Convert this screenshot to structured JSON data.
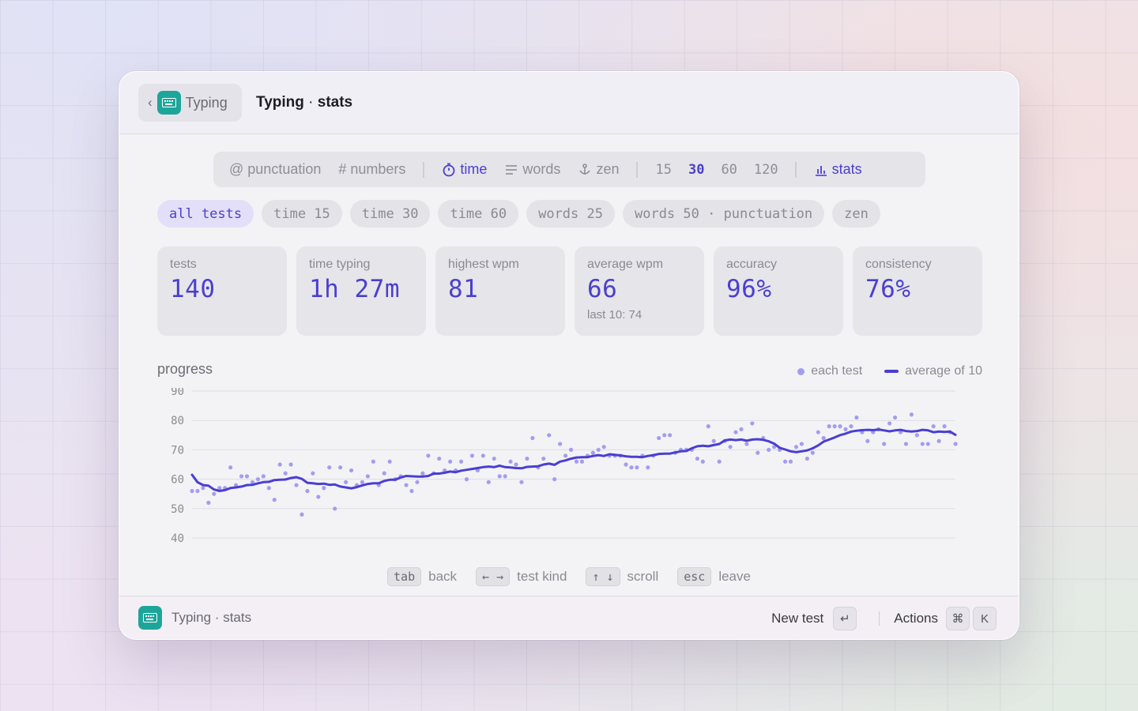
{
  "window": {
    "back_label": "Typing",
    "title_main": "Typing",
    "title_sep": " · ",
    "title_sub": "stats"
  },
  "modebar": {
    "items": [
      {
        "prefix": "@",
        "label": "punctuation"
      },
      {
        "prefix": "#",
        "label": "numbers"
      },
      {
        "label": "time",
        "icon": "stopwatch-icon",
        "active": true
      },
      {
        "label": "words",
        "icon": "lines-icon"
      },
      {
        "label": "zen",
        "icon": "anchor-icon"
      }
    ],
    "durations": [
      "15",
      "30",
      "60",
      "120"
    ],
    "active_duration": "30",
    "stats_label": "stats"
  },
  "filters": [
    "all tests",
    "time 15",
    "time 30",
    "time 60",
    "words 25",
    "words 50 · punctuation",
    "zen"
  ],
  "active_filter": "all tests",
  "cards": [
    {
      "label": "tests",
      "value": "140"
    },
    {
      "label": "time typing",
      "value": "1h 27m"
    },
    {
      "label": "highest wpm",
      "value": "81"
    },
    {
      "label": "average wpm",
      "value": "66",
      "sub": "last 10: 74"
    },
    {
      "label": "accuracy",
      "value": "96%"
    },
    {
      "label": "consistency",
      "value": "76%"
    }
  ],
  "chart": {
    "title": "progress",
    "legend_each": "each test",
    "legend_avg": "average of 10",
    "accent": "#4a3fd0",
    "dot_color": "#a39df0"
  },
  "chart_data": {
    "type": "scatter",
    "ylim": [
      40,
      90
    ],
    "yticks": [
      90,
      80,
      70,
      60,
      50,
      40
    ],
    "grid": true,
    "legend": "top-right",
    "series": [
      {
        "name": "each test",
        "type": "scatter",
        "values": [
          56,
          56,
          57,
          52,
          55,
          57,
          57,
          64,
          58,
          61,
          61,
          59,
          60,
          61,
          57,
          53,
          65,
          62,
          65,
          58,
          48,
          56,
          62,
          54,
          57,
          64,
          50,
          64,
          59,
          63,
          58,
          59,
          61,
          66,
          58,
          62,
          66,
          60,
          61,
          58,
          56,
          59,
          62,
          68,
          62,
          67,
          63,
          66,
          63,
          66,
          60,
          68,
          63,
          68,
          59,
          67,
          61,
          61,
          66,
          65,
          59,
          67,
          74,
          64,
          67,
          75,
          60,
          72,
          68,
          70,
          66,
          66,
          68,
          69,
          70,
          71,
          68,
          68,
          68,
          65,
          64,
          64,
          68,
          64,
          68,
          74,
          75,
          75,
          69,
          70,
          70,
          70,
          67,
          66,
          78,
          73,
          66,
          73,
          71,
          76,
          77,
          72,
          79,
          69,
          74,
          70,
          71,
          70,
          66,
          66,
          71,
          72,
          67,
          69,
          76,
          74,
          78,
          78,
          78,
          77,
          78,
          81,
          76,
          73,
          76,
          77,
          72,
          79,
          81,
          76,
          72,
          82,
          75,
          72,
          72,
          78,
          73,
          78,
          76,
          72
        ]
      },
      {
        "name": "average of 10",
        "type": "line",
        "values": [
          61.5,
          59,
          58,
          57.8,
          56.5,
          56,
          56.3,
          57,
          57.2,
          57.5,
          58,
          58.1,
          58.6,
          59,
          59.1,
          59.7,
          59.8,
          59.9,
          60.4,
          60.7,
          60.1,
          58.8,
          58.6,
          58.4,
          58.5,
          58.1,
          58.2,
          57.5,
          57.2,
          56.9,
          57.3,
          57.9,
          58.4,
          58.6,
          58.6,
          59.4,
          59.8,
          59.8,
          60.6,
          61.1,
          61,
          60.9,
          60.9,
          61.1,
          61.9,
          61.9,
          62.2,
          62.6,
          62.4,
          62.9,
          63.2,
          63.5,
          63.8,
          64.1,
          64.3,
          64.1,
          64.6,
          64.1,
          64.0,
          63.8,
          63.7,
          64.2,
          64.3,
          64.4,
          65,
          65.3,
          64.9,
          66,
          66.4,
          67,
          67.4,
          67.5,
          67.5,
          67.9,
          68.2,
          67.9,
          68.5,
          68.3,
          68.1,
          67.8,
          67.6,
          67.6,
          67.5,
          67.9,
          68.2,
          68.6,
          68.7,
          68.7,
          69.1,
          69.5,
          69.6,
          70.5,
          71.2,
          71.4,
          71.2,
          71.6,
          72,
          73.2,
          73.5,
          73.3,
          73.5,
          73.1,
          73.5,
          73.6,
          73.4,
          72.9,
          72.1,
          70.7,
          70.1,
          69.5,
          69.2,
          69.5,
          69.8,
          70.5,
          71.5,
          72.8,
          73.5,
          74.2,
          75,
          75.5,
          76.2,
          76.5,
          76.7,
          76.8,
          76.7,
          76.9,
          76.6,
          76.3,
          76.6,
          76.8,
          76.4,
          76.2,
          76.4,
          76.8,
          76.6,
          76.0,
          76.2,
          76.1,
          76.2,
          75.1
        ]
      }
    ]
  },
  "hints": [
    {
      "key": "tab",
      "label": "back"
    },
    {
      "key": "← →",
      "label": "test kind"
    },
    {
      "key": "↑ ↓",
      "label": "scroll"
    },
    {
      "key": "esc",
      "label": "leave"
    }
  ],
  "footer": {
    "title": "Typing · stats",
    "new_test": "New test",
    "enter_key": "↵",
    "actions": "Actions",
    "cmd_key": "⌘",
    "k_key": "K"
  }
}
